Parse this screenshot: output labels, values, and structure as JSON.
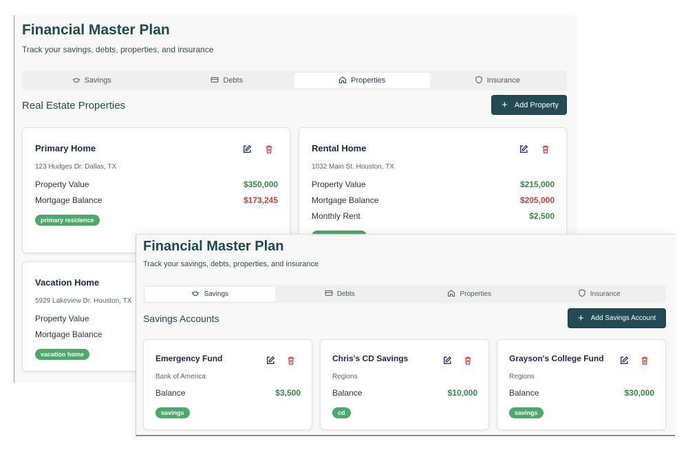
{
  "app": {
    "title": "Financial Master Plan",
    "subtitle": "Track your savings, debts, properties, and insurance"
  },
  "tabs": [
    {
      "label": "Savings",
      "icon": "piggy-bank-icon"
    },
    {
      "label": "Debts",
      "icon": "credit-card-icon"
    },
    {
      "label": "Properties",
      "icon": "home-icon"
    },
    {
      "label": "Insurance",
      "icon": "shield-icon"
    }
  ],
  "properties_view": {
    "active_tab": "Properties",
    "section_title": "Real Estate Properties",
    "add_label": "Add Property",
    "cards": [
      {
        "name": "Primary Home",
        "address": "123 Hudges Dr. Dallas, TX",
        "rows": [
          {
            "label": "Property Value",
            "value": "$350,000",
            "tone": "green"
          },
          {
            "label": "Mortgage Balance",
            "value": "$173,245",
            "tone": "red"
          }
        ],
        "badge": "primary residence"
      },
      {
        "name": "Rental Home",
        "address": "1032 Main St. Houston, TX",
        "rows": [
          {
            "label": "Property Value",
            "value": "$215,000",
            "tone": "green"
          },
          {
            "label": "Mortgage Balance",
            "value": "$205,000",
            "tone": "red"
          },
          {
            "label": "Monthly Rent",
            "value": "$2,500",
            "tone": "green"
          }
        ]
      },
      {
        "name": "Vacation Home",
        "address": "5929 Lakeview Dr. Houston, TX",
        "rows": [
          {
            "label": "Property Value"
          },
          {
            "label": "Mortgage Balance"
          }
        ],
        "badge": "vacation home"
      }
    ]
  },
  "savings_view": {
    "active_tab": "Savings",
    "section_title": "Savings Accounts",
    "add_label": "Add Savings Account",
    "cards": [
      {
        "name": "Emergency Fund",
        "institution": "Bank of America",
        "balance_label": "Balance",
        "balance": "$3,500",
        "badge": "savings"
      },
      {
        "name": "Chris's CD Savings",
        "institution": "Regions",
        "balance_label": "Balance",
        "balance": "$10,000",
        "badge": "cd"
      },
      {
        "name": "Grayson's College Fund",
        "institution": "Regions",
        "balance_label": "Balance",
        "balance": "$30,000",
        "badge": "savings"
      }
    ]
  },
  "colors": {
    "accent": "#234b54",
    "title": "#1c4a4f",
    "positive": "#2f8a3c",
    "negative": "#d33636",
    "badge": "#4caa68",
    "edit_icon": "#1b2a6b"
  }
}
